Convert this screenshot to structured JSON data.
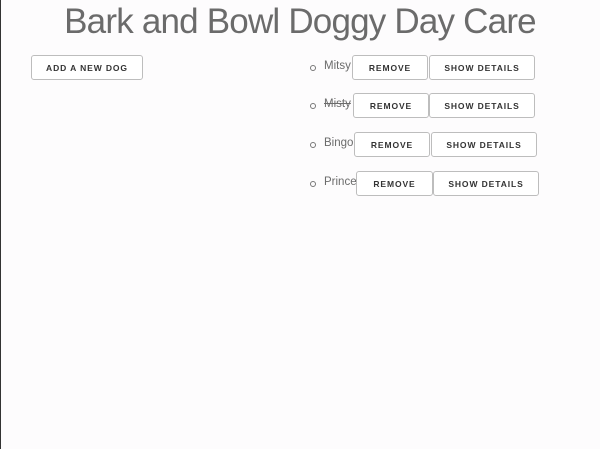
{
  "header": {
    "title": "Bark and Bowl Doggy Day Care"
  },
  "toolbar": {
    "add_dog_label": "ADD A NEW DOG"
  },
  "dogs": [
    {
      "name": "Mitsy",
      "struck": false,
      "remove_label": "REMOVE",
      "details_label": "SHOW DETAILS"
    },
    {
      "name": "Misty",
      "struck": true,
      "remove_label": "REMOVE",
      "details_label": "SHOW DETAILS"
    },
    {
      "name": "Bingo",
      "struck": false,
      "remove_label": "REMOVE",
      "details_label": "SHOW DETAILS"
    },
    {
      "name": "Prince",
      "struck": false,
      "remove_label": "REMOVE",
      "details_label": "SHOW DETAILS"
    }
  ]
}
